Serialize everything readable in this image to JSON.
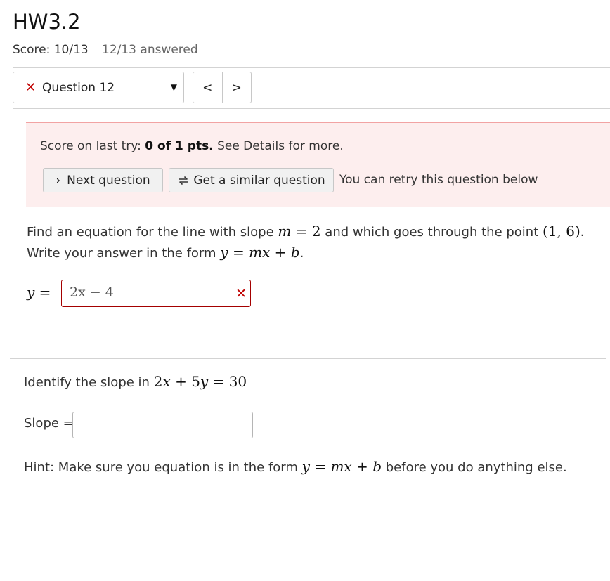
{
  "header": {
    "title": "HW3.2",
    "score": "Score: 10/13",
    "answered": "12/13 answered"
  },
  "question_nav": {
    "selected_question": "Question 12",
    "status_icon": "x-icon",
    "prev_symbol": "<",
    "next_symbol": ">"
  },
  "alert": {
    "prefix": "Score on last try:",
    "score_bold": "0 of 1 pts.",
    "suffix": "See Details for more.",
    "next_button": "Next question",
    "similar_button": "Get a similar question",
    "retry_text": "You can retry this question below"
  },
  "part1": {
    "text_a": "Find an equation for the line with slope",
    "text_b": "and which goes through the point",
    "text_c": "Write your answer in the form",
    "answer_label": "=",
    "answer_value": "2x − 4"
  },
  "part2": {
    "prompt": "Identify the slope in",
    "slope_label": "Slope =",
    "slope_value": "",
    "hint_a": "Hint: Make sure you equation is in the form",
    "hint_b": "before you do anything else."
  },
  "colors": {
    "error": "#c00000",
    "alert_bg": "#fdeeee",
    "alert_border": "#f2a3a3",
    "input_error_border": "#a40000"
  }
}
